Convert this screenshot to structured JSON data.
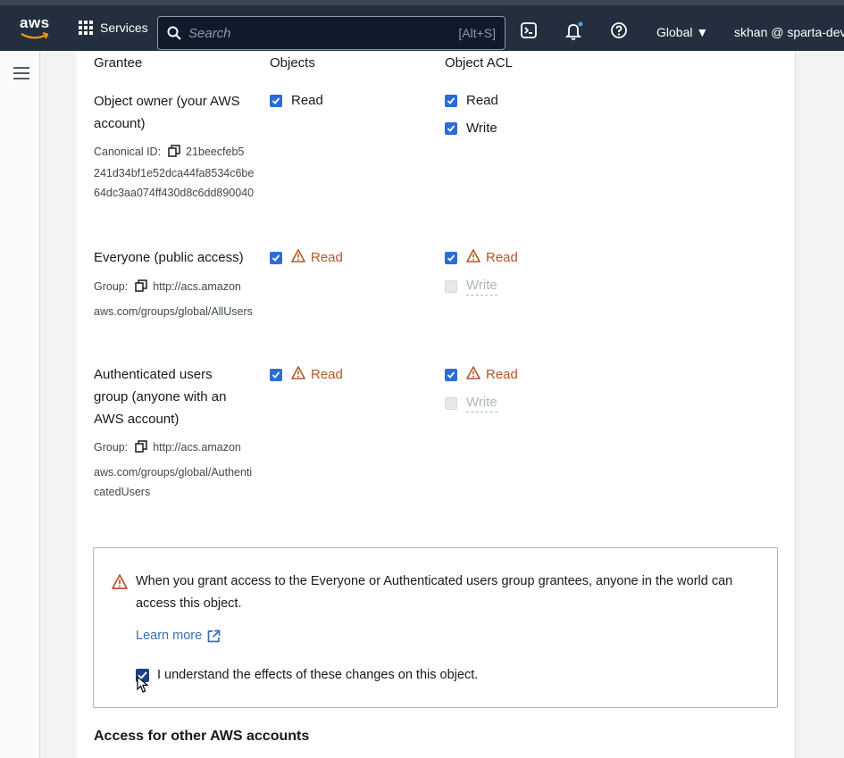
{
  "nav": {
    "logo": "aws",
    "services_label": "Services",
    "search_placeholder": "Search",
    "search_shortcut": "[Alt+S]",
    "region": "Global ▼",
    "user": "skhan @ sparta-devop"
  },
  "table": {
    "headers": {
      "grantee": "Grantee",
      "objects": "Objects",
      "object_acl": "Object ACL"
    },
    "rows": [
      {
        "title": "Object owner (your AWS account)",
        "meta_label": "Canonical ID:",
        "meta_value_first": "21beecfeb5",
        "meta_value_rest": "241d34bf1e52dca44fa8534c6be64dc3aa074ff430d8c6dd890040",
        "objects_read": "Read",
        "acl_read": "Read",
        "acl_write": "Write"
      },
      {
        "title": "Everyone (public access)",
        "meta_label": "Group:",
        "meta_value_first": "http://acs.amazon",
        "meta_value_rest": "aws.com/groups/global/AllUsers",
        "objects_read": "Read",
        "acl_read": "Read",
        "acl_write": "Write"
      },
      {
        "title": "Authenticated users group (anyone with an AWS account)",
        "meta_label": "Group:",
        "meta_value_first": "http://acs.amazon",
        "meta_value_rest": "aws.com/groups/global/AuthenticatedUsers",
        "objects_read": "Read",
        "acl_read": "Read",
        "acl_write": "Write"
      }
    ]
  },
  "alert": {
    "message": "When you grant access to the Everyone or Authenticated users group grantees, anyone in the world can access this object.",
    "learn_more": "Learn more",
    "acknowledge": "I understand the effects of these changes on this object."
  },
  "next_section": "Access for other AWS accounts",
  "colors": {
    "nav_bg": "#232f3e",
    "checkbox": "#2e6bd6",
    "warning": "#b2562a",
    "link": "#3b6fb3"
  }
}
